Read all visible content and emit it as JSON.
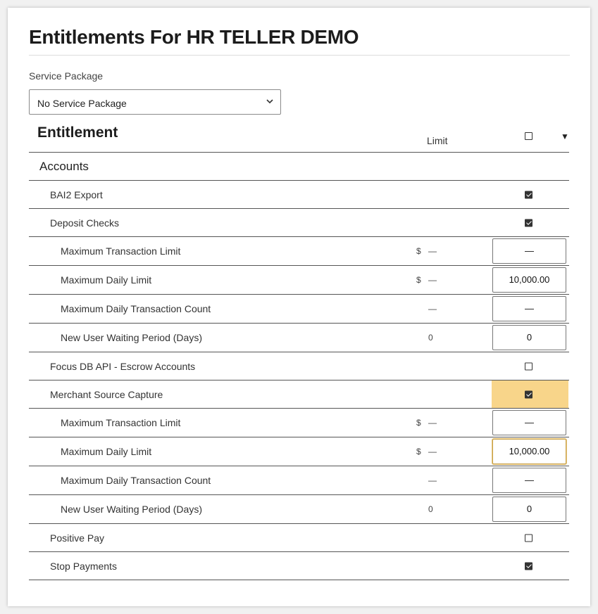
{
  "page": {
    "title": "Entitlements For HR TELLER DEMO"
  },
  "service_package": {
    "label": "Service Package",
    "selected": "No Service Package"
  },
  "table": {
    "col_entitlement": "Entitlement",
    "col_limit": "Limit",
    "sections": [
      {
        "name": "Accounts",
        "items": [
          {
            "label": "BAI2 Export",
            "checked": true
          },
          {
            "label": "Deposit Checks",
            "checked": true,
            "limits": [
              {
                "label": "Maximum Transaction Limit",
                "currency": "$",
                "current": "—",
                "value": "—"
              },
              {
                "label": "Maximum Daily Limit",
                "currency": "$",
                "current": "—",
                "value": "10,000.00"
              },
              {
                "label": "Maximum Daily Transaction Count",
                "currency": "",
                "current": "—",
                "value": "—"
              },
              {
                "label": "New User Waiting Period (Days)",
                "currency": "",
                "current": "0",
                "value": "0"
              }
            ]
          },
          {
            "label": "Focus DB API - Escrow Accounts",
            "checked": false
          },
          {
            "label": "Merchant Source Capture",
            "checked": true,
            "highlighted": true,
            "limits": [
              {
                "label": "Maximum Transaction Limit",
                "currency": "$",
                "current": "—",
                "value": "—"
              },
              {
                "label": "Maximum Daily Limit",
                "currency": "$",
                "current": "—",
                "value": "10,000.00",
                "focused": true
              },
              {
                "label": "Maximum Daily Transaction Count",
                "currency": "",
                "current": "—",
                "value": "—"
              },
              {
                "label": "New User Waiting Period (Days)",
                "currency": "",
                "current": "0",
                "value": "0"
              }
            ]
          },
          {
            "label": "Positive Pay",
            "checked": false
          },
          {
            "label": "Stop Payments",
            "checked": true
          }
        ]
      }
    ]
  },
  "colors": {
    "highlight": "#f8d58a",
    "rule": "#555555",
    "checkbox": "#333333"
  },
  "icons": {
    "select_chevron": "chevron-down-icon",
    "column_menu": "caret-down-icon"
  }
}
